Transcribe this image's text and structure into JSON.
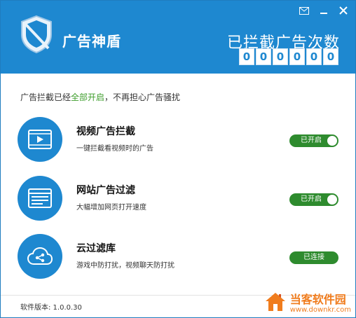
{
  "app": {
    "title": "广告神盾",
    "logo_text": "广告"
  },
  "counter": {
    "label": "已拦截广告次数",
    "digits": [
      "0",
      "0",
      "0",
      "0",
      "0",
      "0"
    ]
  },
  "status": {
    "prefix": "广告拦截已经",
    "highlight": "全部开启",
    "suffix": "，不再担心广告骚扰"
  },
  "features": [
    {
      "title": "视频广告拦截",
      "desc": "一键拦截看视频时的广告",
      "action": "已开启",
      "icon": "video-icon"
    },
    {
      "title": "网站广告过滤",
      "desc": "大幅增加网页打开速度",
      "action": "已开启",
      "icon": "browser-icon"
    },
    {
      "title": "云过滤库",
      "desc": "游戏中防打扰，视频聊天防打扰",
      "action": "已连接",
      "icon": "cloud-share-icon"
    }
  ],
  "footer": {
    "version": "软件版本: 1.0.0.30"
  },
  "watermark": {
    "name": "当客软件园",
    "url": "www.downkr.com"
  },
  "colors": {
    "primary": "#1e88d0",
    "green": "#2e8b2e",
    "highlight": "#3e9e2c",
    "watermark": "#f07c1d"
  }
}
